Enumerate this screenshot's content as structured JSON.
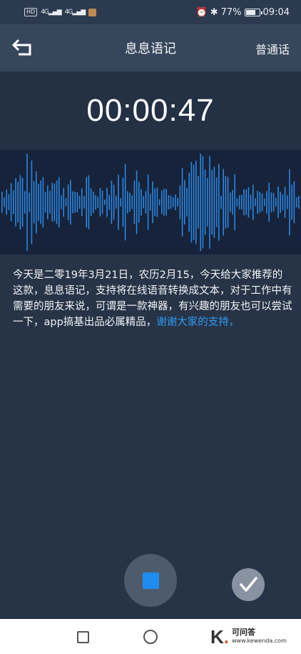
{
  "status_bar": {
    "left_chip": "HD",
    "signal1": "4G",
    "signal2": "4G",
    "battery_text": "77%",
    "time": "09:04",
    "battery_level": 0.77,
    "icons": [
      "alarm-icon",
      "bluetooth-icon",
      "battery-icon"
    ]
  },
  "header": {
    "title": "息息语记",
    "language": "普通话",
    "back_icon": "back-arrow-icon"
  },
  "timer": "00:00:47",
  "transcript": {
    "text": "今天是二零19年3月21日，农历2月15，今天给大家推荐的这款，息息语记，支持将在线语音转换成文本，对于工作中有需要的朋友来说，可谓是一款神器，有兴趣的朋友也可以尝试一下，app搞基出品必属精品，",
    "highlight": "谢谢大家的支持，"
  },
  "controls": {
    "stop_icon": "stop-icon",
    "done_icon": "checkmark-icon"
  },
  "colors": {
    "accent": "#1e8cf0",
    "highlight_text": "#2f9bf2",
    "waveform": "#2d86e0"
  },
  "watermark": {
    "logo": "K",
    "name": "可问答",
    "url": "www.kewenda.com"
  }
}
